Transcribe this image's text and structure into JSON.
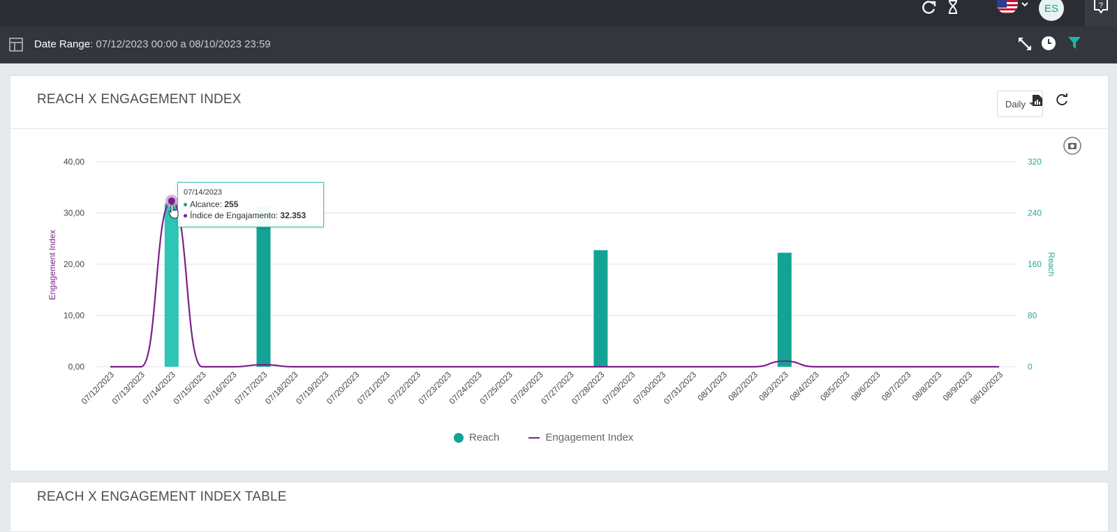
{
  "topbar": {
    "avatar_initials": "ES",
    "icons": [
      "refresh-icon",
      "hourglass-icon",
      "us-flag-icon",
      "chevron-down-icon",
      "help-chat-icon"
    ]
  },
  "subbar": {
    "date_range_label": "Date Range",
    "date_range_value": ": 07/12/2023 00:00 a 08/10/2023 23:59",
    "icons": [
      "layout-icon",
      "expand-icon",
      "clock-icon",
      "filter-icon"
    ]
  },
  "card1": {
    "title": "REACH X ENGAGEMENT INDEX",
    "period_select": "Daily"
  },
  "card2": {
    "title": "REACH X ENGAGEMENT INDEX TABLE"
  },
  "tooltip": {
    "date": "07/14/2023",
    "reach_label": "Alcance: ",
    "reach_value": "255",
    "engagement_label": "Índice de Engajamento: ",
    "engagement_value": "32.353"
  },
  "colors": {
    "reach": "#12a394",
    "reach_highlight": "#2ec4b6",
    "engagement": "#7a1f8a"
  },
  "chart_data": {
    "type": "bar",
    "categories": [
      "07/12/2023",
      "07/13/2023",
      "07/14/2023",
      "07/15/2023",
      "07/16/2023",
      "07/17/2023",
      "07/18/2023",
      "07/19/2023",
      "07/20/2023",
      "07/21/2023",
      "07/22/2023",
      "07/23/2023",
      "07/24/2023",
      "07/25/2023",
      "07/26/2023",
      "07/27/2023",
      "07/28/2023",
      "07/29/2023",
      "07/30/2023",
      "07/31/2023",
      "08/1/2023",
      "08/2/2023",
      "08/3/2023",
      "08/4/2023",
      "08/5/2023",
      "08/6/2023",
      "08/7/2023",
      "08/8/2023",
      "08/9/2023",
      "08/10/2023"
    ],
    "series": [
      {
        "name": "Reach",
        "type": "bar",
        "axis": "right",
        "values": [
          0,
          0,
          255,
          0,
          0,
          250,
          0,
          0,
          0,
          0,
          0,
          0,
          0,
          0,
          0,
          0,
          182,
          0,
          0,
          0,
          0,
          0,
          178,
          0,
          0,
          0,
          0,
          0,
          0,
          0
        ]
      },
      {
        "name": "Engagement Index",
        "type": "line",
        "axis": "left",
        "values": [
          0,
          0,
          32.353,
          0,
          0,
          0.4,
          0,
          0,
          0,
          0,
          0,
          0,
          0,
          0,
          0,
          0,
          0,
          0,
          0,
          0,
          0,
          0,
          1.1,
          0,
          0,
          0,
          0,
          0,
          0,
          0
        ]
      }
    ],
    "ylabel_left": "Engagement Index",
    "ylabel_right": "Reach",
    "ylim_left": [
      0,
      40
    ],
    "ylim_right": [
      0,
      320
    ],
    "yticks_left": [
      "0,00",
      "10,00",
      "20,00",
      "30,00",
      "40,00"
    ],
    "yticks_right": [
      "0",
      "80",
      "160",
      "240",
      "320"
    ],
    "grid": true,
    "legend": "bottom-center"
  }
}
